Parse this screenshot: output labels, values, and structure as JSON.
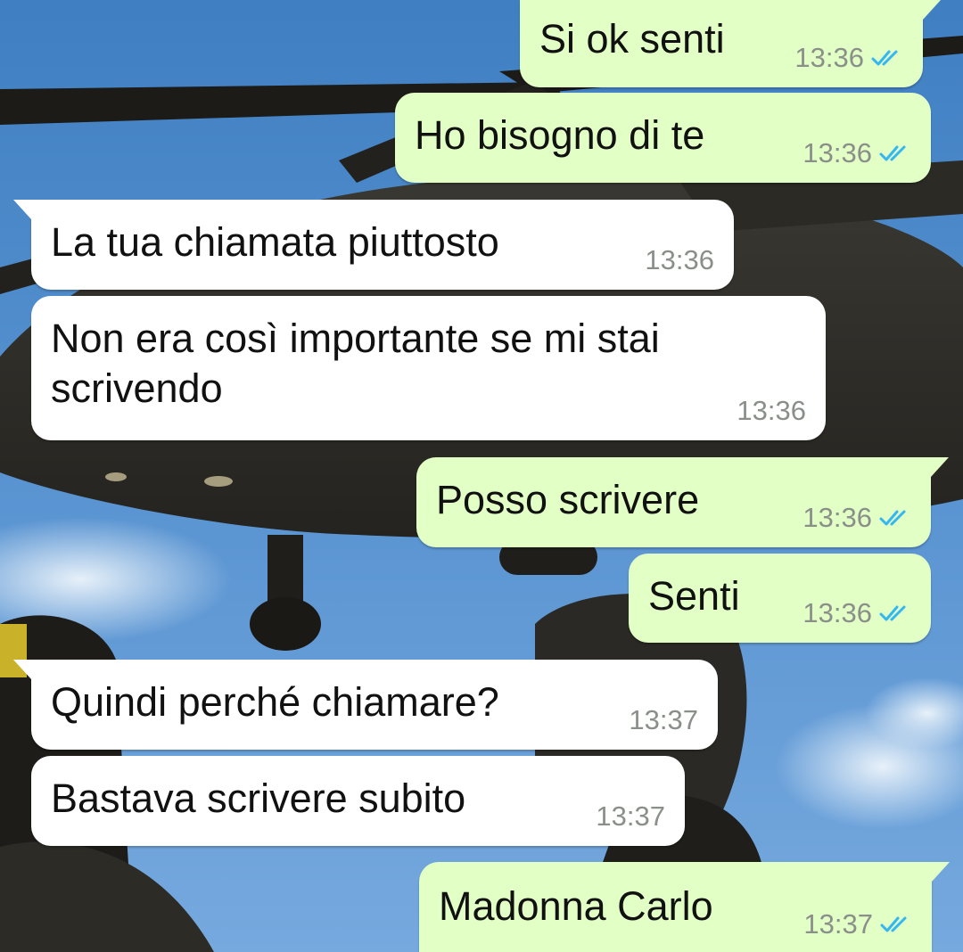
{
  "conversation": {
    "messages": [
      {
        "direction": "out",
        "text": "Si ok senti",
        "time": "13:36",
        "status": "read"
      },
      {
        "direction": "out",
        "text": "Ho bisogno di te",
        "time": "13:36",
        "status": "read"
      },
      {
        "direction": "in",
        "text": "La tua chiamata piuttosto",
        "time": "13:36"
      },
      {
        "direction": "in",
        "text": "Non era così importante se mi stai scrivendo",
        "time": "13:36"
      },
      {
        "direction": "out",
        "text": "Posso scrivere",
        "time": "13:36",
        "status": "read"
      },
      {
        "direction": "out",
        "text": "Senti",
        "time": "13:36",
        "status": "read"
      },
      {
        "direction": "in",
        "text": "Quindi perché chiamare?",
        "time": "13:37"
      },
      {
        "direction": "in",
        "text": "Bastava scrivere subito",
        "time": "13:37"
      },
      {
        "direction": "out",
        "text": "Madonna Carlo",
        "time": "13:37",
        "status": "read"
      }
    ]
  },
  "theme": {
    "outgoing_bubble": "#e2ffc6",
    "incoming_bubble": "#ffffff",
    "timestamp_color": "#8a8f8a",
    "read_ticks_color": "#34b7f1",
    "read_icon": "double-check-icon",
    "wallpaper": "helicopter-and-soldiers-photo"
  }
}
